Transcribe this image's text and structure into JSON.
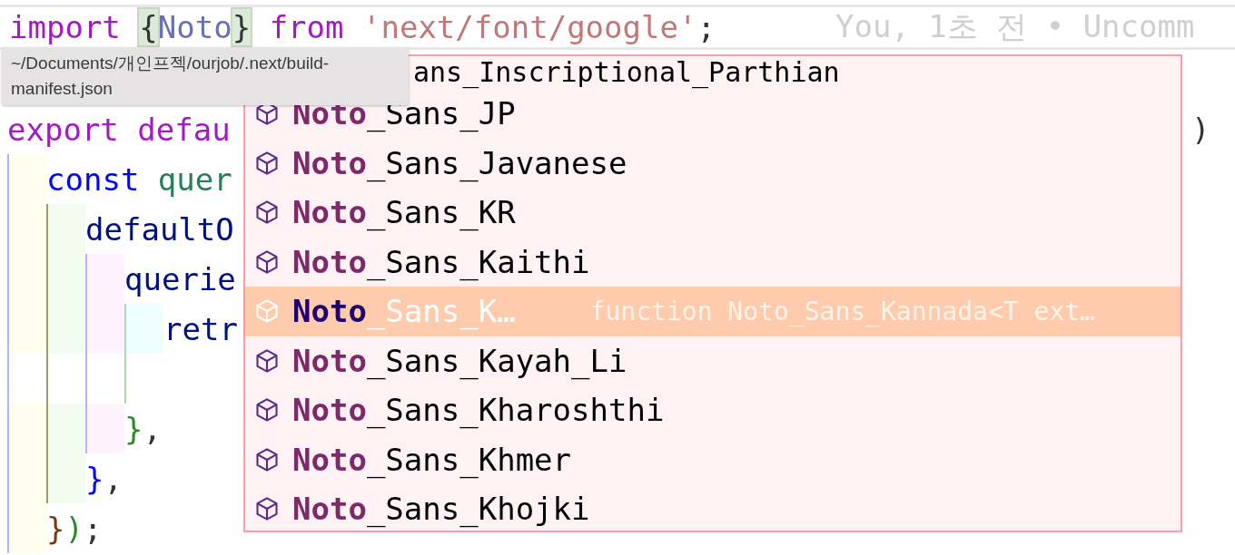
{
  "editor": {
    "lines": [
      {
        "kind": "code",
        "current": true,
        "tokens": [
          {
            "text": "import ",
            "kind": "keyword"
          },
          {
            "text": "{",
            "kind": "punct",
            "matched": true
          },
          {
            "text": "Noto",
            "kind": "name",
            "cursor": true
          },
          {
            "text": "}",
            "kind": "punct",
            "matched": true
          },
          {
            "text": " from ",
            "kind": "keyword"
          },
          {
            "text": "'next/font/google'",
            "kind": "string"
          },
          {
            "text": ";",
            "kind": "punct"
          }
        ],
        "blame": "You, 1초 전 • Uncomm"
      },
      {
        "kind": "blank"
      },
      {
        "kind": "code",
        "tokens": [
          {
            "text": "export defau",
            "kind": "keyword"
          }
        ],
        "tail": ")"
      },
      {
        "kind": "code",
        "guides": [
          {
            "color": "#fffff0"
          }
        ],
        "tokens": [
          {
            "text": "const ",
            "kind": "storage"
          },
          {
            "text": "quer",
            "kind": "variable"
          }
        ]
      },
      {
        "kind": "code",
        "guides": [
          {
            "color": "#fffff0"
          },
          {
            "color": "#f2fdf0"
          }
        ],
        "tokens": [
          {
            "text": "defaultO",
            "kind": "property"
          }
        ]
      },
      {
        "kind": "code",
        "guides": [
          {
            "color": "#fffff0"
          },
          {
            "color": "#f2fdf0"
          },
          {
            "color": "#fdf2fd"
          }
        ],
        "tokens": [
          {
            "text": "querie",
            "kind": "property"
          }
        ]
      },
      {
        "kind": "code",
        "guides": [
          {
            "color": "#fffff0"
          },
          {
            "color": "#f2fdf0"
          },
          {
            "color": "#fdf2fd"
          },
          {
            "color": "#effefe"
          }
        ],
        "tokens": [
          {
            "text": "retr",
            "kind": "property"
          }
        ]
      },
      {
        "kind": "blank",
        "guides": [
          {
            "color": "#ffffff"
          },
          {
            "color": "#ffffff"
          },
          {
            "color": "#ffffff"
          },
          {
            "color": "#ffffff"
          }
        ]
      },
      {
        "kind": "code",
        "guides": [
          {
            "color": "#fffff0"
          },
          {
            "color": "#f2fdf0"
          },
          {
            "color": "#fdf2fd"
          }
        ],
        "tokens": [
          {
            "text": "}",
            "kind": "brace3"
          },
          {
            "text": ",",
            "kind": "punct"
          }
        ]
      },
      {
        "kind": "code",
        "guides": [
          {
            "color": "#fffff0"
          },
          {
            "color": "#f2fdf0"
          }
        ],
        "tokens": [
          {
            "text": "}",
            "kind": "brace2"
          },
          {
            "text": ",",
            "kind": "punct"
          }
        ]
      },
      {
        "kind": "code",
        "guides": [
          {
            "color": "#fffff0"
          }
        ],
        "tokens": [
          {
            "text": "}",
            "kind": "brace1"
          },
          {
            "text": ")",
            "kind": "brace3"
          },
          {
            "text": ";",
            "kind": "punct"
          }
        ]
      }
    ]
  },
  "suggestions": [
    {
      "kind": "partial",
      "rest": "ans_Inscriptional_Parthian"
    },
    {
      "kind": "item",
      "match": "Noto",
      "rest": "_Sans_JP",
      "selected": false
    },
    {
      "kind": "item",
      "match": "Noto",
      "rest": "_Sans_Javanese",
      "selected": false
    },
    {
      "kind": "item",
      "match": "Noto",
      "rest": "_Sans_KR",
      "selected": false
    },
    {
      "kind": "item",
      "match": "Noto",
      "rest": "_Sans_Kaithi",
      "selected": false
    },
    {
      "kind": "item",
      "match": "Noto",
      "rest": "_Sans_K…",
      "selected": true,
      "detail": "function Noto_Sans_Kannada<T ext…"
    },
    {
      "kind": "item",
      "match": "Noto",
      "rest": "_Sans_Kayah_Li",
      "selected": false
    },
    {
      "kind": "item",
      "match": "Noto",
      "rest": "_Sans_Kharoshthi",
      "selected": false
    },
    {
      "kind": "item",
      "match": "Noto",
      "rest": "_Sans_Khmer",
      "selected": false
    },
    {
      "kind": "item",
      "match": "Noto",
      "rest": "_Sans_Khojki",
      "selected": false
    }
  ],
  "tooltip": {
    "text": "~/Documents/개인프젝/ourjob/.next/build-manifest.json"
  }
}
